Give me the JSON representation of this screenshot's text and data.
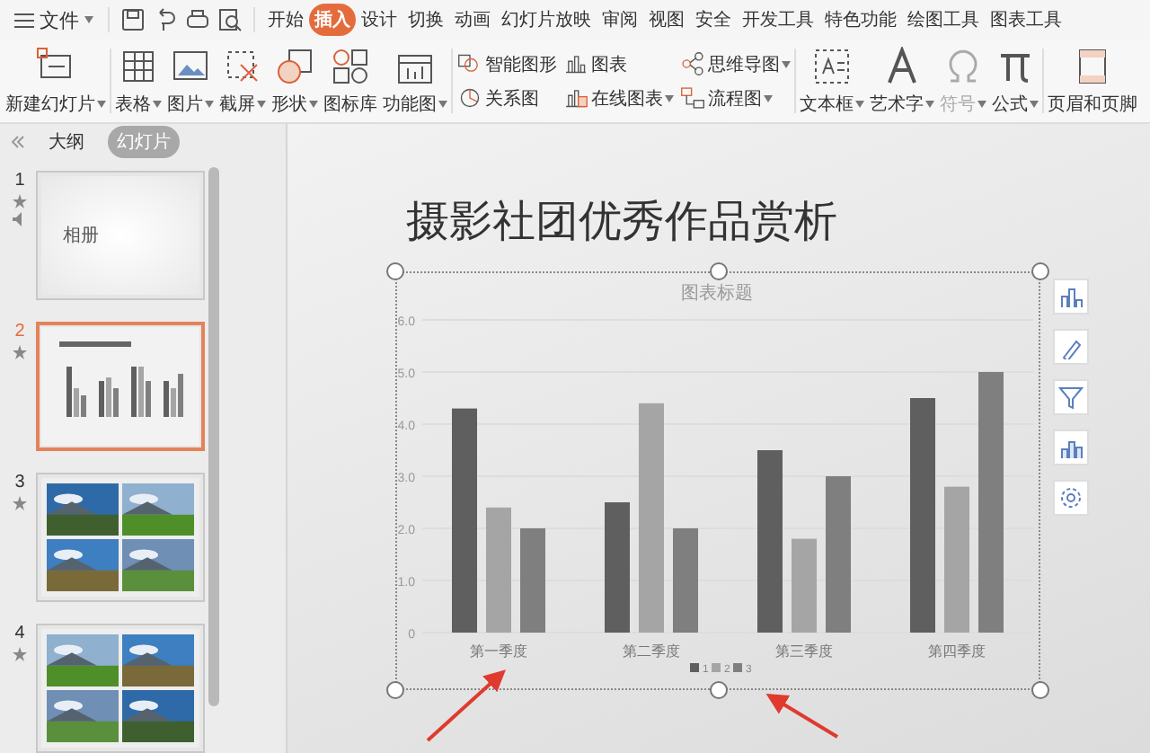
{
  "menu": {
    "label": "文件"
  },
  "ribbon_tabs": [
    {
      "label": "开始",
      "selected": false
    },
    {
      "label": "插入",
      "selected": true
    },
    {
      "label": "设计",
      "selected": false
    },
    {
      "label": "切换",
      "selected": false
    },
    {
      "label": "动画",
      "selected": false
    },
    {
      "label": "幻灯片放映",
      "selected": false
    },
    {
      "label": "审阅",
      "selected": false
    },
    {
      "label": "视图",
      "selected": false
    },
    {
      "label": "安全",
      "selected": false
    },
    {
      "label": "开发工具",
      "selected": false
    },
    {
      "label": "特色功能",
      "selected": false
    },
    {
      "label": "绘图工具",
      "selected": false
    },
    {
      "label": "图表工具",
      "selected": false
    }
  ],
  "tools": [
    {
      "kind": "large",
      "label": "新建幻灯片",
      "dropdown": true,
      "disabled": false
    },
    {
      "kind": "large",
      "label": "表格",
      "dropdown": true,
      "disabled": false
    },
    {
      "kind": "large",
      "label": "图片",
      "dropdown": true,
      "disabled": false
    },
    {
      "kind": "large",
      "label": "截屏",
      "dropdown": true,
      "disabled": false
    },
    {
      "kind": "large",
      "label": "形状",
      "dropdown": true,
      "disabled": false
    },
    {
      "kind": "large",
      "label": "图标库",
      "dropdown": false,
      "disabled": false
    },
    {
      "kind": "large",
      "label": "功能图",
      "dropdown": true,
      "disabled": false
    },
    {
      "kind": "stack",
      "items": [
        {
          "label": "智能图形",
          "dropdown": false,
          "disabled": false
        },
        {
          "label": "关系图",
          "dropdown": false,
          "disabled": false
        }
      ]
    },
    {
      "kind": "stack",
      "items": [
        {
          "label": "图表",
          "dropdown": false,
          "disabled": false
        },
        {
          "label": "在线图表",
          "dropdown": true,
          "disabled": false
        }
      ]
    },
    {
      "kind": "stack",
      "items": [
        {
          "label": "思维导图",
          "dropdown": true,
          "disabled": false
        },
        {
          "label": "流程图",
          "dropdown": true,
          "disabled": false
        }
      ]
    },
    {
      "kind": "large",
      "label": "文本框",
      "dropdown": true,
      "disabled": false
    },
    {
      "kind": "large",
      "label": "艺术字",
      "dropdown": true,
      "disabled": false
    },
    {
      "kind": "large",
      "label": "符号",
      "dropdown": true,
      "disabled": true
    },
    {
      "kind": "large",
      "label": "公式",
      "dropdown": true,
      "disabled": false
    },
    {
      "kind": "large",
      "label": "页眉和页脚",
      "dropdown": false,
      "disabled": false
    }
  ],
  "view_tabs": [
    {
      "label": "大纲",
      "selected": false
    },
    {
      "label": "幻灯片",
      "selected": true
    }
  ],
  "slides": [
    {
      "number": "1",
      "selected": false,
      "has_audio": true,
      "thumbnail": {
        "kind": "title",
        "title": "相册"
      }
    },
    {
      "number": "2",
      "selected": true,
      "has_audio": false,
      "thumbnail": {
        "kind": "chart"
      }
    },
    {
      "number": "3",
      "selected": false,
      "has_audio": false
    },
    {
      "number": "4",
      "selected": false,
      "has_audio": false
    }
  ],
  "slide": {
    "title": "摄影社团优秀作品赏析",
    "chart": {
      "chart_data": {
        "type": "bar",
        "title": "图表标题",
        "categories": [
          "第一季度",
          "第二季度",
          "第三季度",
          "第四季度"
        ],
        "series": [
          {
            "name": "1",
            "color": "#5f5f5f",
            "values": [
              4.3,
              2.5,
              3.5,
              4.5
            ]
          },
          {
            "name": "2",
            "color": "#a5a5a5",
            "values": [
              2.4,
              4.4,
              1.8,
              2.8
            ]
          },
          {
            "name": "3",
            "color": "#7f7f7f",
            "values": [
              2,
              2,
              3,
              5
            ]
          }
        ],
        "ylim": [
          0,
          6
        ],
        "grid": true,
        "legend": true,
        "yticks": [
          {
            "value": 0,
            "label": "0"
          },
          {
            "value": 1,
            "label": "1.0"
          },
          {
            "value": 2,
            "label": "2.0"
          },
          {
            "value": 3,
            "label": "3.0"
          },
          {
            "value": 4,
            "label": "4.0"
          },
          {
            "value": 5,
            "label": "5.0"
          },
          {
            "value": 6,
            "label": "6.0"
          }
        ]
      }
    }
  }
}
